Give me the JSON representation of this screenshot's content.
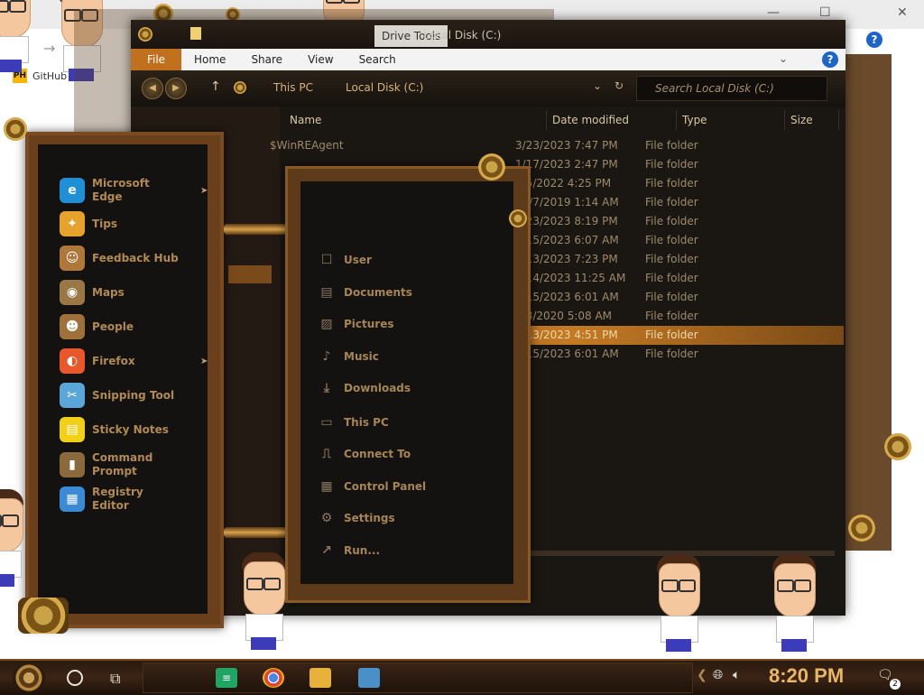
{
  "browser": {
    "bookmark_label": "GitHub",
    "bookmark_logo_text": "PH",
    "close_icon": "close-icon"
  },
  "explorer": {
    "context_tab": "Drive Tools",
    "title": "Local Disk (C:)",
    "ribbon_tabs": [
      "File",
      "Home",
      "Share",
      "View",
      "Search"
    ],
    "breadcrumb": [
      "This PC",
      "Local Disk (C:)"
    ],
    "search_placeholder": "Search Local Disk (C:)",
    "columns": [
      "Name",
      "Date modified",
      "Type",
      "Size"
    ],
    "files": [
      {
        "name": "$WinREAgent",
        "date": "3/23/2023 7:47 PM",
        "type": "File folder"
      },
      {
        "name": "",
        "date": "1/17/2023 2:47 PM",
        "type": "File folder"
      },
      {
        "name": "",
        "date": "7/5/2022 4:25 PM",
        "type": "File folder"
      },
      {
        "name": "",
        "date": "12/7/2019 1:14 AM",
        "type": "File folder"
      },
      {
        "name": "",
        "date": "3/23/2023 8:19 PM",
        "type": "File folder"
      },
      {
        "name": "",
        "date": "3/15/2023 6:07 AM",
        "type": "File folder"
      },
      {
        "name": "",
        "date": "3/13/2023 7:23 PM",
        "type": "File folder"
      },
      {
        "name": "",
        "date": "3/14/2023 11:25 AM",
        "type": "File folder"
      },
      {
        "name": "",
        "date": "3/15/2023 6:01 AM",
        "type": "File folder"
      },
      {
        "name": "",
        "date": "3/8/2020 5:08 AM",
        "type": "File folder"
      },
      {
        "name": "",
        "date": "3/13/2023 4:51 PM",
        "type": "File folder",
        "selected": true
      },
      {
        "name": "",
        "date": "3/15/2023 6:01 AM",
        "type": "File folder"
      }
    ]
  },
  "start_menu": {
    "apps": [
      {
        "label": "Microsoft Edge",
        "icon": "edge-icon",
        "color": "#1f8fd6",
        "submenu": true
      },
      {
        "label": "Tips",
        "icon": "lightbulb-icon",
        "color": "#e6a22a",
        "submenu": false
      },
      {
        "label": "Feedback Hub",
        "icon": "feedback-icon",
        "color": "#b07838",
        "submenu": false
      },
      {
        "label": "Maps",
        "icon": "map-pin-icon",
        "color": "#9a7846",
        "submenu": false
      },
      {
        "label": "People",
        "icon": "people-icon",
        "color": "#a0703a",
        "submenu": false
      },
      {
        "label": "Firefox",
        "icon": "firefox-icon",
        "color": "#e8582a",
        "submenu": true
      },
      {
        "label": "Snipping Tool",
        "icon": "scissors-icon",
        "color": "#5aa6d8",
        "submenu": false
      },
      {
        "label": "Sticky Notes",
        "icon": "sticky-note-icon",
        "color": "#f2d018",
        "submenu": false
      },
      {
        "label": "Command Prompt",
        "icon": "terminal-icon",
        "color": "#8a6a3a",
        "submenu": false
      },
      {
        "label": "Registry Editor",
        "icon": "registry-icon",
        "color": "#3a8ad6",
        "submenu": false
      }
    ],
    "places": [
      {
        "label": "User",
        "icon": "user-icon"
      },
      {
        "label": "Documents",
        "icon": "document-icon"
      },
      {
        "label": "Pictures",
        "icon": "picture-icon"
      },
      {
        "label": "Music",
        "icon": "music-icon"
      },
      {
        "label": "Downloads",
        "icon": "download-icon"
      },
      {
        "label": "This PC",
        "icon": "computer-icon"
      },
      {
        "label": "Connect To",
        "icon": "network-icon"
      },
      {
        "label": "Control Panel",
        "icon": "control-panel-icon"
      },
      {
        "label": "Settings",
        "icon": "gear-icon"
      },
      {
        "label": "Run...",
        "icon": "run-icon"
      }
    ]
  },
  "taskbar": {
    "clock": "8:20 PM",
    "notification_count": "2",
    "pinned": [
      "sheets-icon",
      "chrome-icon",
      "folder-icon",
      "photos-icon"
    ]
  }
}
